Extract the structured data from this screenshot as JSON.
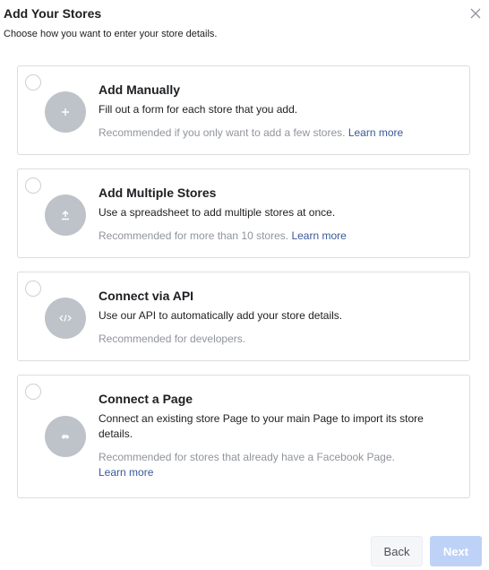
{
  "header": {
    "title": "Add Your Stores",
    "subtitle": "Choose how you want to enter your store details."
  },
  "options": [
    {
      "title": "Add Manually",
      "description": "Fill out a form for each store that you add.",
      "recommendation": "Recommended if you only want to add a few stores.",
      "link": "Learn more",
      "icon": "plus-icon"
    },
    {
      "title": "Add Multiple Stores",
      "description": "Use a spreadsheet to add multiple stores at once.",
      "recommendation": "Recommended for more than 10 stores.",
      "link": "Learn more",
      "icon": "upload-icon"
    },
    {
      "title": "Connect via API",
      "description": "Use our API to automatically add your store details.",
      "recommendation": "Recommended for developers.",
      "link": "",
      "icon": "code-icon"
    },
    {
      "title": "Connect a Page",
      "description": "Connect an existing store Page to your main Page to import its store details.",
      "recommendation": "Recommended for stores that already have a Facebook Page.",
      "link": "Learn more",
      "icon": "connect-icon"
    }
  ],
  "footer": {
    "back_label": "Back",
    "next_label": "Next"
  },
  "colors": {
    "link": "#385898",
    "icon_bg": "#bec3c9",
    "next_disabled_bg": "#bed2f7"
  }
}
